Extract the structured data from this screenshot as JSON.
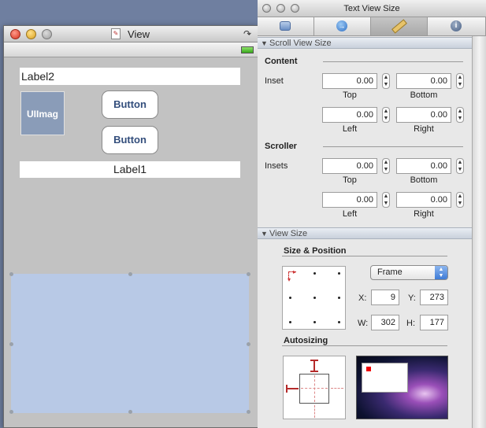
{
  "view_window": {
    "title": "View",
    "labels": {
      "label2": "Label2",
      "label1": "Label1",
      "image": "UIImag"
    },
    "buttons": {
      "top": "Button",
      "bottom": "Button"
    }
  },
  "inspector": {
    "title": "Text View Size",
    "tabs": [
      {
        "icon": "attributes-icon"
      },
      {
        "icon": "connections-icon"
      },
      {
        "icon": "ruler-icon"
      },
      {
        "icon": "info-icon"
      }
    ],
    "scroll_view_size": {
      "header": "Scroll View Size",
      "content": {
        "group": "Content",
        "row_label": "Inset",
        "top": "0.00",
        "bottom": "0.00",
        "left": "0.00",
        "right": "0.00",
        "captions": {
          "top": "Top",
          "bottom": "Bottom",
          "left": "Left",
          "right": "Right"
        }
      },
      "scroller": {
        "group": "Scroller",
        "row_label": "Insets",
        "top": "0.00",
        "bottom": "0.00",
        "left": "0.00",
        "right": "0.00",
        "captions": {
          "top": "Top",
          "bottom": "Bottom",
          "left": "Left",
          "right": "Right"
        }
      }
    },
    "view_size": {
      "header": "View Size",
      "size_position": {
        "title": "Size & Position",
        "frame_select": "Frame",
        "x_label": "X:",
        "x": "9",
        "y_label": "Y:",
        "y": "273",
        "w_label": "W:",
        "w": "302",
        "h_label": "H:",
        "h": "177"
      },
      "autosizing": {
        "title": "Autosizing"
      }
    }
  }
}
